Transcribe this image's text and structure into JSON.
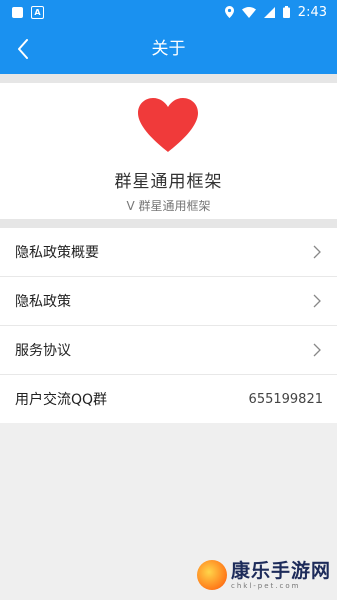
{
  "status_bar": {
    "time": "2:43"
  },
  "header": {
    "title": "关于"
  },
  "app": {
    "name": "群星通用框架",
    "version": "V 群星通用框架"
  },
  "menu": [
    {
      "label": "隐私政策概要"
    },
    {
      "label": "隐私政策"
    },
    {
      "label": "服务协议"
    },
    {
      "label": "用户交流QQ群",
      "value": "655199821"
    }
  ],
  "watermark": {
    "title": "康乐手游网",
    "url": "chkl-pet.com"
  },
  "colors": {
    "primary": "#1a91f0",
    "heart": "#f03a3a"
  },
  "icons": [
    "back-arrow-icon",
    "heart-icon",
    "chevron-right-icon"
  ]
}
